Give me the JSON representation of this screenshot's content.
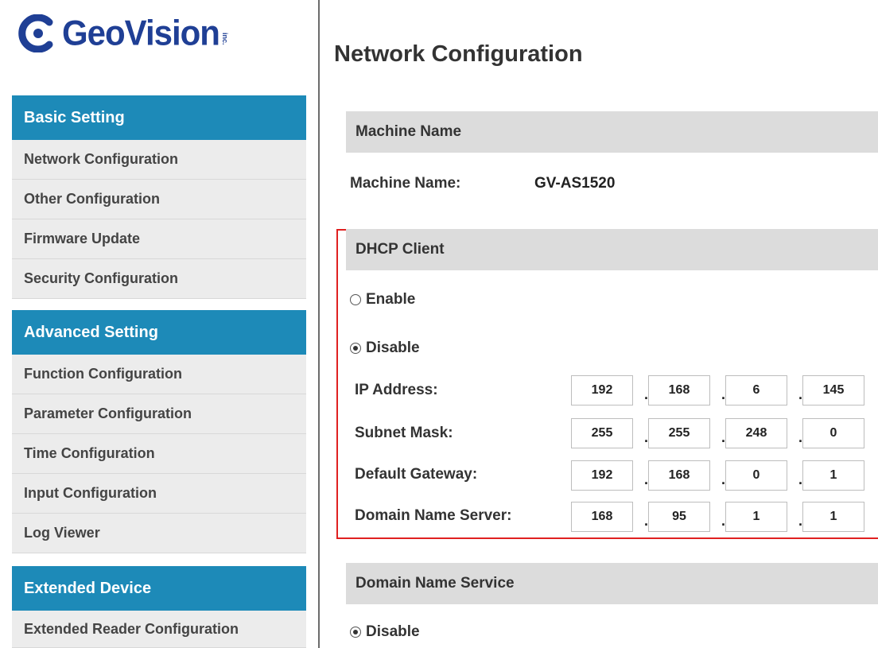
{
  "brand": {
    "name": "GeoVision",
    "inc": "inc."
  },
  "sidebar": {
    "sections": [
      {
        "title": "Basic Setting",
        "items": [
          "Network Configuration",
          "Other Configuration",
          "Firmware Update",
          "Security Configuration"
        ]
      },
      {
        "title": "Advanced Setting",
        "items": [
          "Function Configuration",
          "Parameter Configuration",
          "Time Configuration",
          "Input Configuration",
          "Log Viewer"
        ]
      },
      {
        "title": "Extended Device",
        "items": [
          "Extended Reader Configuration"
        ]
      }
    ]
  },
  "main": {
    "title": "Network Configuration",
    "machine": {
      "header": "Machine Name",
      "label": "Machine Name:",
      "value": "GV-AS1520"
    },
    "dhcp": {
      "header": "DHCP Client",
      "options": [
        {
          "label": "Enable",
          "checked": false
        },
        {
          "label": "Disable",
          "checked": true
        }
      ],
      "fields": [
        {
          "label": "IP Address:",
          "octets": [
            "192",
            "168",
            "6",
            "145"
          ]
        },
        {
          "label": "Subnet Mask:",
          "octets": [
            "255",
            "255",
            "248",
            "0"
          ]
        },
        {
          "label": "Default Gateway:",
          "octets": [
            "192",
            "168",
            "0",
            "1"
          ]
        },
        {
          "label": "Domain Name Server:",
          "octets": [
            "168",
            "95",
            "1",
            "1"
          ]
        }
      ]
    },
    "dns_service": {
      "header": "Domain Name Service",
      "options": [
        {
          "label": "Disable",
          "checked": true
        }
      ]
    }
  },
  "colors": {
    "accent": "#1d8ab8",
    "brand": "#1f3f95",
    "highlight_border": "#e02020"
  }
}
